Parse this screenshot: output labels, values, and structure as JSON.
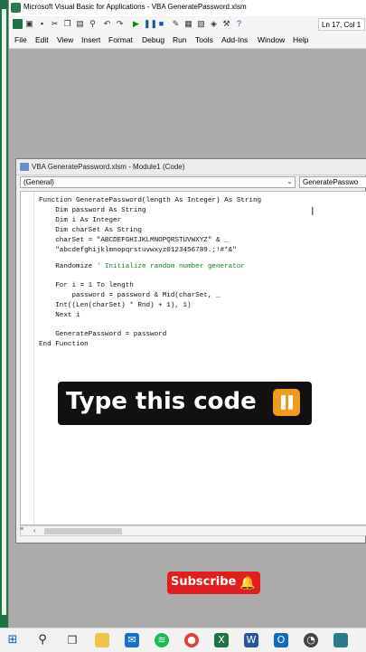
{
  "app": {
    "title": "Microsoft Visual Basic for Applications - VBA GeneratePassword.xlsm",
    "cursor_position": "Ln 17, Col 1"
  },
  "menu": [
    "File",
    "Edit",
    "View",
    "Insert",
    "Format",
    "Debug",
    "Run",
    "Tools",
    "Add-Ins",
    "Window",
    "Help"
  ],
  "code_window": {
    "title": "VBA GeneratePassword.xlsm - Module1 (Code)",
    "object_dropdown": "(General)",
    "procedure_dropdown": "GeneratePasswo",
    "lines": [
      "Function GeneratePassword(length As Integer) As String",
      "    Dim password As String",
      "    Dim i As Integer",
      "    Dim charSet As String",
      "    charSet = \"ABCDEFGHIJKLMNOPQRSTUVWXYZ\" & _",
      "    \"abcdefghijklmnopqrstuvwxyz0123456789.;!#*&\"",
      "",
      "    Randomize",
      "",
      "    For i = 1 To length",
      "        password = password & Mid(charSet, _",
      "    Int((Len(charSet) * Rnd) + 1), 1)",
      "    Next i",
      "",
      "    GeneratePassword = password",
      "End Function"
    ],
    "comment": "' Initialize random number generator"
  },
  "overlay": {
    "caption": "Type this code",
    "subscribe": "Subscribe"
  },
  "colors": {
    "excel_green": "#1f7244",
    "comment_green": "#1d7a1d",
    "caption_bg": "#111111",
    "pause_orange": "#f19a1c",
    "subscribe_red": "#e21d1d"
  }
}
